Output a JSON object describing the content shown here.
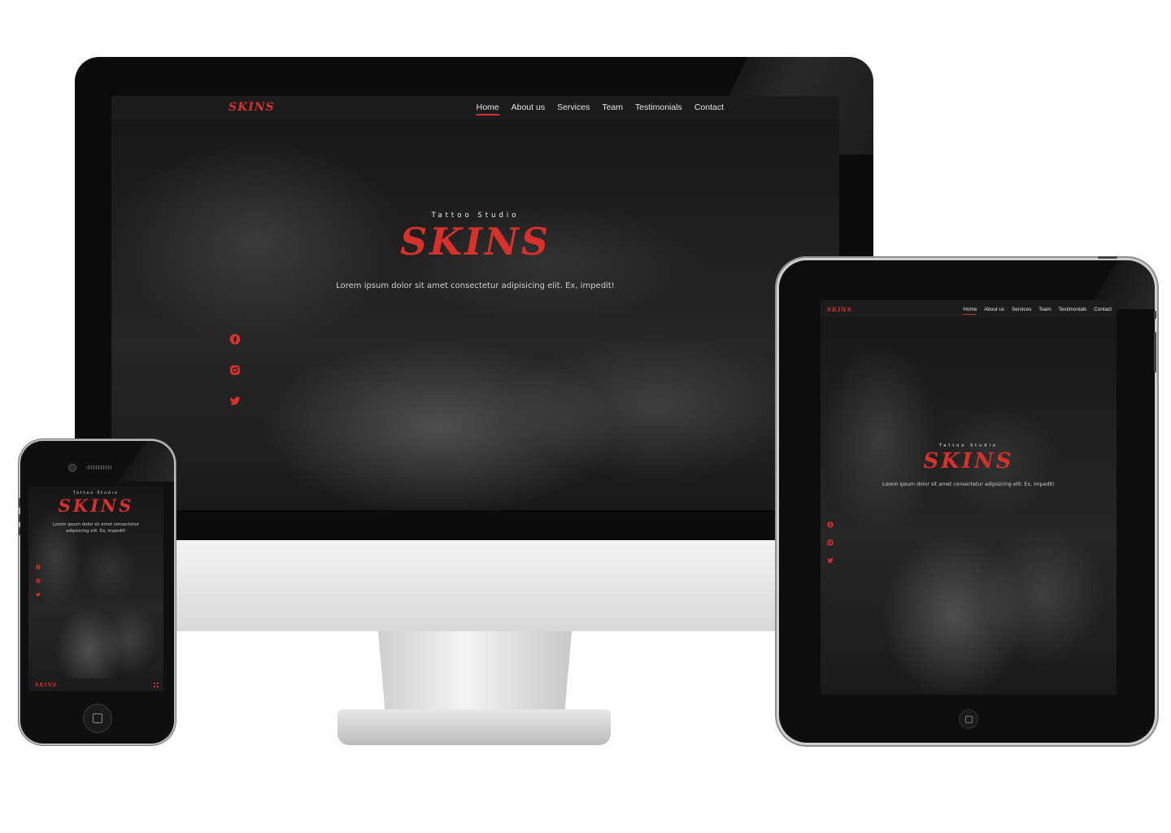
{
  "brand": {
    "logo": "SKINS",
    "tagline": "Tattoo Studio",
    "lead": "Lorem ipsum dolor sit amet consectetur adipisicing elit. Ex, impedit!"
  },
  "nav": {
    "items": [
      {
        "label": "Home",
        "active": true
      },
      {
        "label": "About us",
        "active": false
      },
      {
        "label": "Services",
        "active": false
      },
      {
        "label": "Team",
        "active": false
      },
      {
        "label": "Testimonials",
        "active": false
      },
      {
        "label": "Contact",
        "active": false
      }
    ]
  },
  "social": [
    "facebook-icon",
    "instagram-icon",
    "twitter-icon"
  ],
  "colors": {
    "accent": "#d6312b",
    "navbar": "#1c1c1c",
    "text": "#e6e6e6"
  }
}
